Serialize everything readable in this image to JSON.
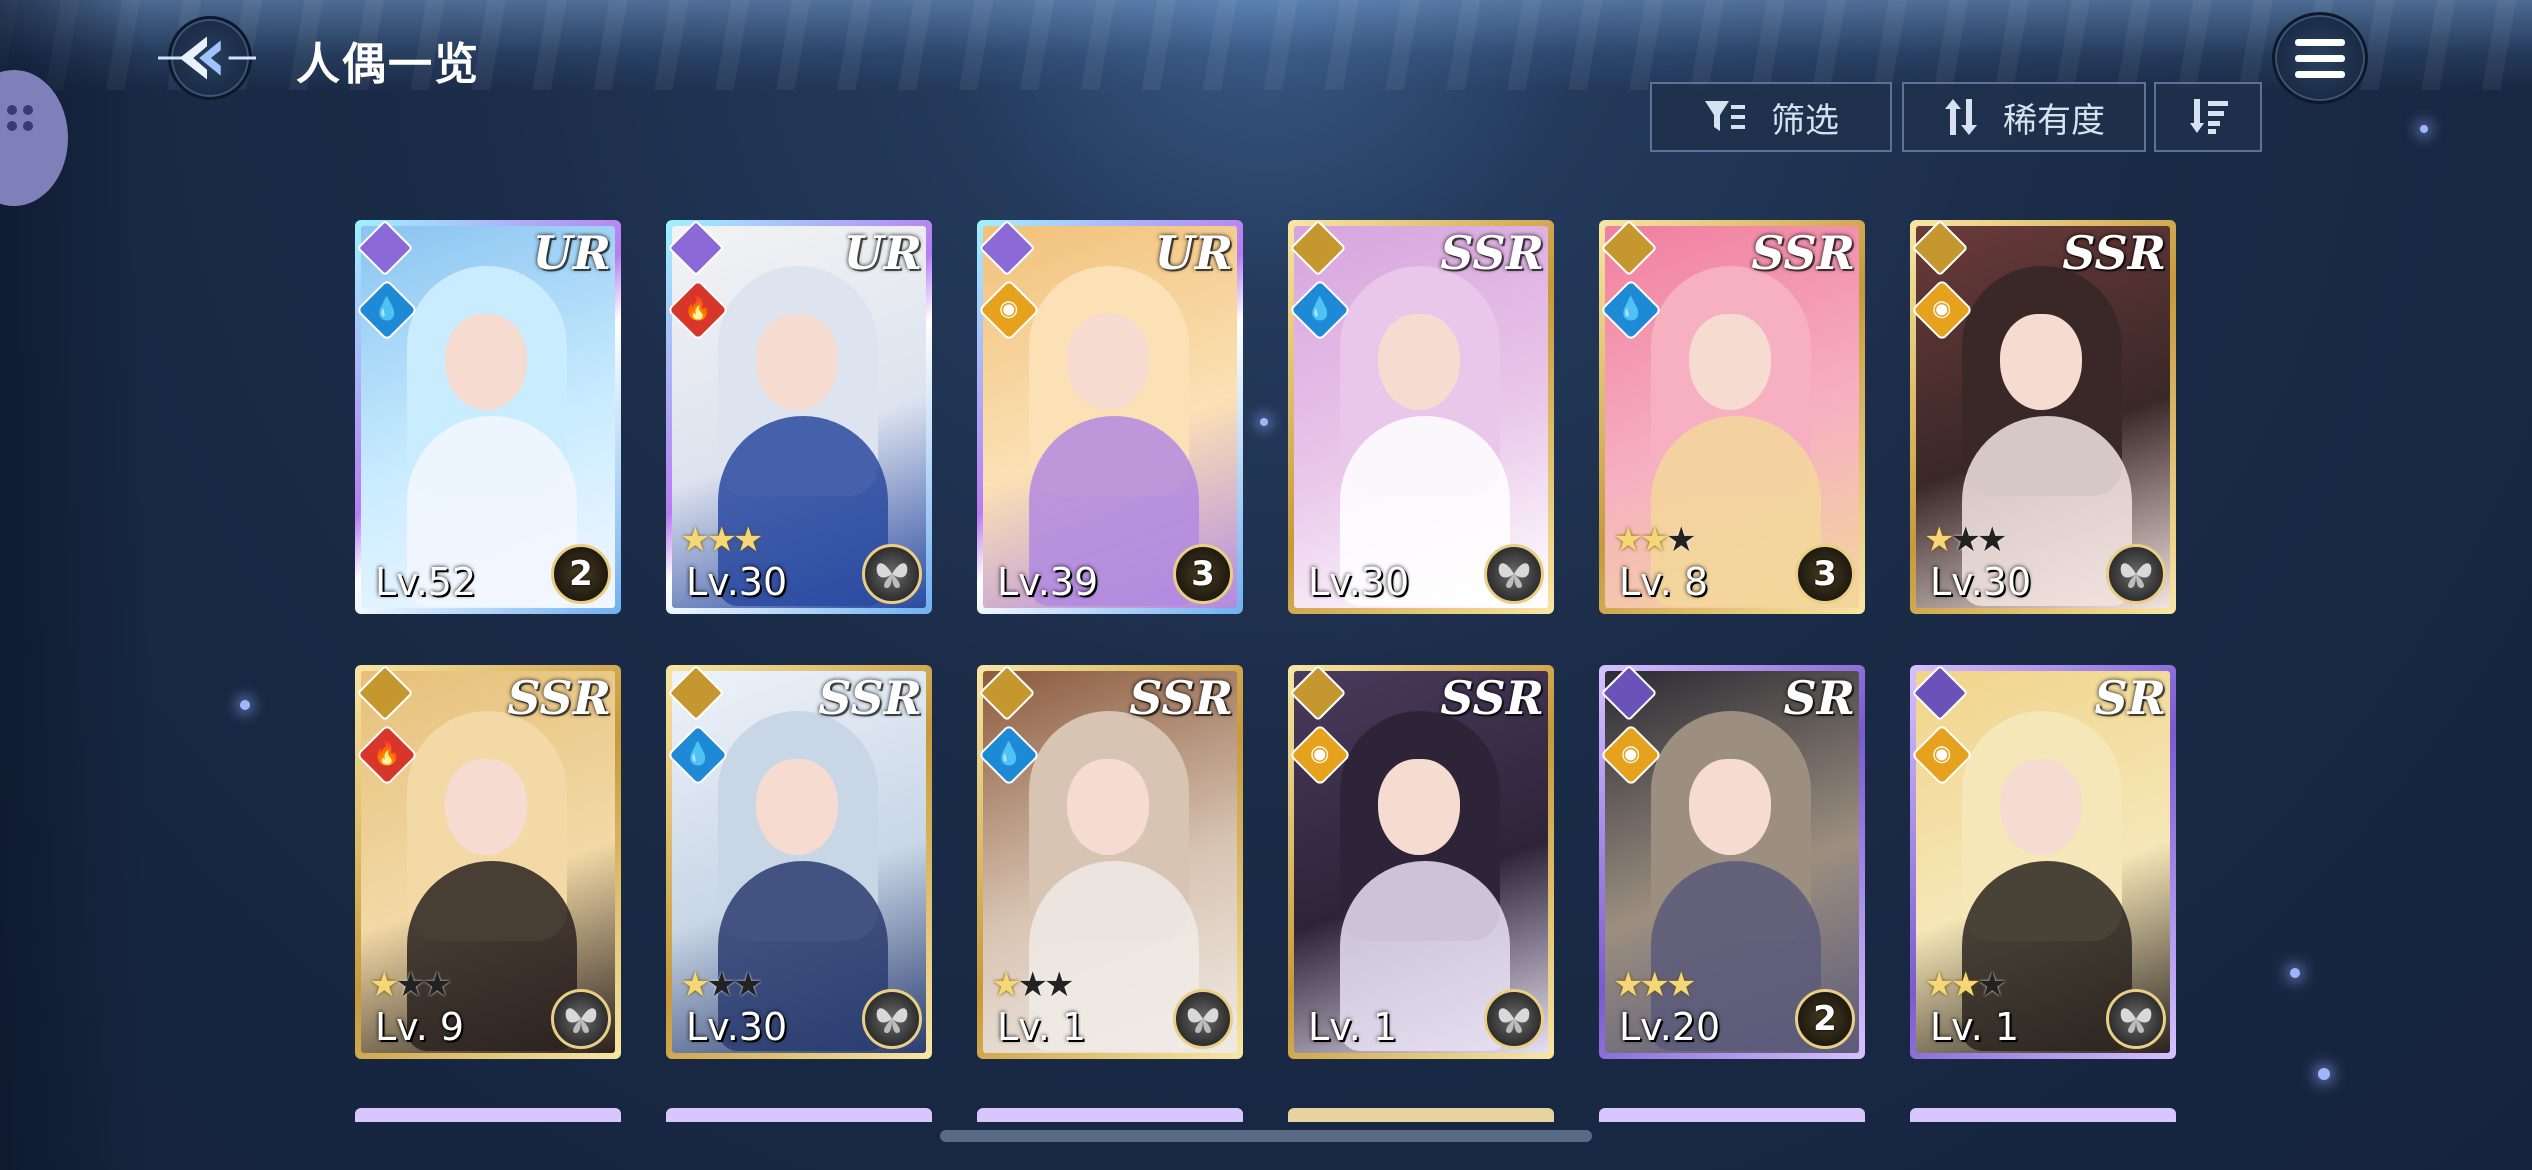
{
  "header": {
    "title": "人偶一览"
  },
  "toolbar": {
    "filter_label": "筛选",
    "sort_label": "稀有度"
  },
  "colors": {
    "water": "#1b2c48",
    "ur": "#b87cf2",
    "ssr": "#c7993b",
    "sr": "#7a5bd0",
    "water_elem": "#1e8ad6",
    "fire_elem": "#d8362a",
    "light_elem": "#e6a21c"
  },
  "cards": [
    {
      "rarity": "UR",
      "level": "Lv.52",
      "stars": 0,
      "badge": "2",
      "element": "water-icon",
      "class": "moon-icon"
    },
    {
      "rarity": "UR",
      "level": "Lv.30",
      "stars": 3,
      "badge": "",
      "element": "fire-icon",
      "class": "sword-icon"
    },
    {
      "rarity": "UR",
      "level": "Lv.39",
      "stars": 0,
      "badge": "3",
      "element": "light-icon",
      "class": "wings-icon"
    },
    {
      "rarity": "SSR",
      "level": "Lv.30",
      "stars": 0,
      "badge": "",
      "element": "water-icon",
      "class": "moon-icon"
    },
    {
      "rarity": "SSR",
      "level": "Lv. 8",
      "stars": 2,
      "badge": "3",
      "element": "water-icon",
      "class": "arrow-icon"
    },
    {
      "rarity": "SSR",
      "level": "Lv.30",
      "stars": 1,
      "badge": "",
      "element": "light-icon",
      "class": "hammer-icon"
    },
    {
      "rarity": "SSR",
      "level": "Lv. 9",
      "stars": 1,
      "badge": "",
      "element": "fire-icon",
      "class": "arrow-icon"
    },
    {
      "rarity": "SSR",
      "level": "Lv.30",
      "stars": 1,
      "badge": "",
      "element": "water-icon",
      "class": "moon-icon"
    },
    {
      "rarity": "SSR",
      "level": "Lv. 1",
      "stars": 1,
      "badge": "",
      "element": "water-icon",
      "class": "wings-icon"
    },
    {
      "rarity": "SSR",
      "level": "Lv. 1",
      "stars": 0,
      "badge": "",
      "element": "light-icon",
      "class": "moon-icon"
    },
    {
      "rarity": "SR",
      "level": "Lv.20",
      "stars": 3,
      "badge": "2",
      "element": "light-icon",
      "class": "sword-icon"
    },
    {
      "rarity": "SR",
      "level": "Lv. 1",
      "stars": 2,
      "badge": "",
      "element": "light-icon",
      "class": "hammer-icon"
    }
  ]
}
